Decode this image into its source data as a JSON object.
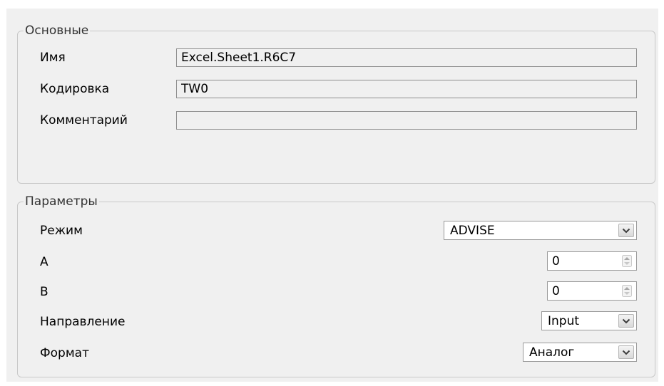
{
  "basic": {
    "legend": "Основные",
    "name_label": "Имя",
    "name_value": "Excel.Sheet1.R6C7",
    "encoding_label": "Кодировка",
    "encoding_value": "TW0",
    "comment_label": "Комментарий",
    "comment_value": ""
  },
  "params": {
    "legend": "Параметры",
    "mode_label": "Режим",
    "mode_value": "ADVISE",
    "a_label": "A",
    "a_value": "0",
    "b_label": "B",
    "b_value": "0",
    "direction_label": "Направление",
    "direction_value": "Input",
    "format_label": "Формат",
    "format_value": "Аналог"
  },
  "icons": {
    "dropdown": "chevron-down-icon",
    "spinner": "spinner-icon"
  }
}
